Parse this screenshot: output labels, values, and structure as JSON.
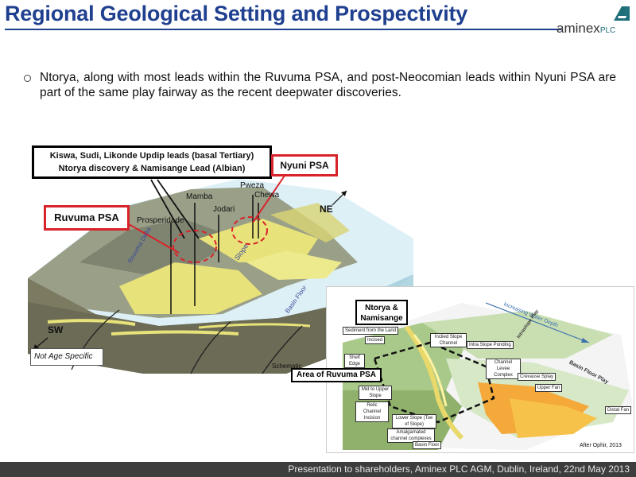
{
  "header": {
    "title": "Regional Geological Setting and Prospectivity",
    "logo_text": "aminex",
    "logo_suffix": "PLC"
  },
  "bullet": {
    "text": "Ntorya, along with most leads within the Ruvuma PSA, and post-Neocomian leads within Nyuni PSA are part of the same play fairway as the recent deepwater discoveries."
  },
  "block_diagram": {
    "callout_leads_line1": "Kiswa, Sudi, Likonde Updip leads (basal Tertiary)",
    "callout_leads_line2": "Ntorya discovery & Namisange Lead (Albian)",
    "callout_nyuni": "Nyuni PSA",
    "callout_ruvuma": "Ruvuma PSA",
    "well_labels": [
      "Mamba",
      "Pweza",
      "Chewa",
      "Jodari",
      "Prosperidade"
    ],
    "direction_ne": "NE",
    "direction_sw": "SW",
    "surface_labels": [
      "Rovuma Delta",
      "Slope",
      "Basin Floor"
    ],
    "not_age_specific": "Not Age Specific",
    "schematic_label": "Schematic"
  },
  "inset_diagram": {
    "callout_ntorya_line1": "Ntorya &",
    "callout_ntorya_line2": "Namisange",
    "callout_area": "Area of Ruvuma PSA",
    "top_label": "Increasing Water Depth",
    "labels": [
      "Sediment from the Land",
      "Incised",
      "Inclied Slope Channel",
      "Intra Slope Ponding",
      "Channel Levee Complex",
      "Crevasse Splay",
      "Upper Fan",
      "Distal Fan",
      "Basin Floor Play",
      "Intraslope Play",
      "Shelf Edge",
      "Mid to Upper Slope",
      "Relic Channel Incision",
      "Lower Slope (Toe of Slope)",
      "Amalgamated channel complexes",
      "Basin Floor"
    ],
    "credit": "After Ophir, 2013"
  },
  "footer": {
    "text": "Presentation to shareholders, Aminex PLC AGM, Dublin, Ireland, 22nd May 2013"
  },
  "colors": {
    "title_blue": "#1f3f8f",
    "callout_red": "#d8232a",
    "footer_bg": "#3d3d3d"
  }
}
